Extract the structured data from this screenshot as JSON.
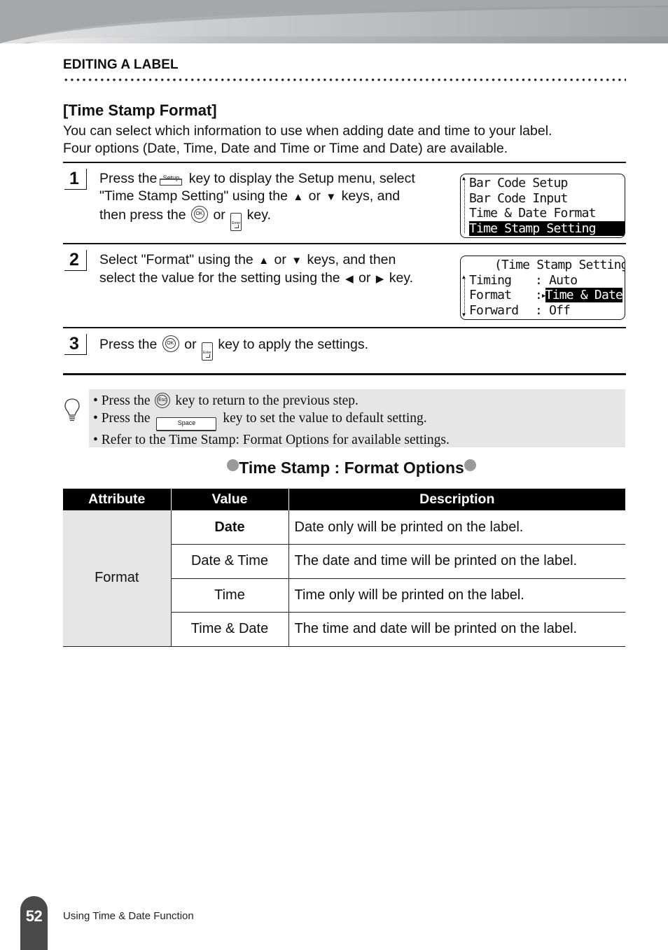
{
  "header": {
    "section_label": "EDITING A LABEL"
  },
  "section": {
    "title": "[Time Stamp Format]",
    "intro_line1": "You can select which information to use when adding date and time to your label.",
    "intro_line2": "Four options (Date, Time, Date and Time or Time and Date) are available."
  },
  "steps": [
    {
      "number": "1",
      "text_parts": {
        "a": "Press the",
        "key_setup": "Setup",
        "b": "key to display the Setup menu, select",
        "c": "\"Time Stamp Setting\" using the",
        "up": "▲",
        "or1": "or",
        "down": "▼",
        "d": "keys, and",
        "e": "then press the",
        "key_ok": "OK",
        "or2": "or",
        "key_enter": "Enter",
        "f": "key."
      },
      "lcd": {
        "rows": [
          "Bar Code Setup",
          "Bar Code Input",
          "Time & Date Format",
          "Time Stamp Setting"
        ],
        "selected_index": 3
      }
    },
    {
      "number": "2",
      "text_parts": {
        "a": "Select \"Format\" using the",
        "up": "▲",
        "or1": "or",
        "down": "▼",
        "b": "keys, and then",
        "c": "select the value for the setting using the",
        "left": "◀",
        "or2": "or",
        "right": "▶",
        "d": "key."
      },
      "lcd": {
        "title": "(Time Stamp Setting)",
        "rows": [
          {
            "label": "Timing",
            "sep": ":",
            "value": "Auto"
          },
          {
            "label": "Format",
            "sep": ":",
            "value": "Time & Date",
            "selected": true
          },
          {
            "label": "Forward",
            "sep": ":",
            "value": "Off"
          }
        ]
      }
    },
    {
      "number": "3",
      "text_parts": {
        "a": "Press the",
        "key_ok": "OK",
        "or1": "or",
        "key_enter": "Enter",
        "b": "key to apply the settings."
      }
    }
  ],
  "hints": {
    "items": [
      {
        "a": "Press the",
        "key": "Esc",
        "b": "key to return to the previous step."
      },
      {
        "a": "Press the",
        "key": "Space",
        "b": "key to set the value to default setting."
      },
      {
        "a": "Refer to the Time Stamp: Format Options for available settings."
      }
    ],
    "bullet": "•"
  },
  "options_table": {
    "heading": "Time Stamp : Format Options",
    "columns": [
      "Attribute",
      "Value",
      "Description"
    ],
    "attribute": "Format",
    "rows": [
      {
        "value": "Date",
        "description": "Date only will be printed on the label.",
        "bold": true
      },
      {
        "value": "Date & Time",
        "description": "The date and time will be printed on the label."
      },
      {
        "value": "Time",
        "description": "Time only will be printed on the label."
      },
      {
        "value": "Time & Date",
        "description": "The time and date will be printed on the label."
      }
    ]
  },
  "footer": {
    "page_number": "52",
    "chapter": "Using Time & Date Function"
  },
  "colors": {
    "banner_gray": "#a9aaac",
    "hint_bg": "#e6e6e6",
    "page_tab": "#4a4a4a",
    "bullet_dot": "#9a9a9a"
  }
}
